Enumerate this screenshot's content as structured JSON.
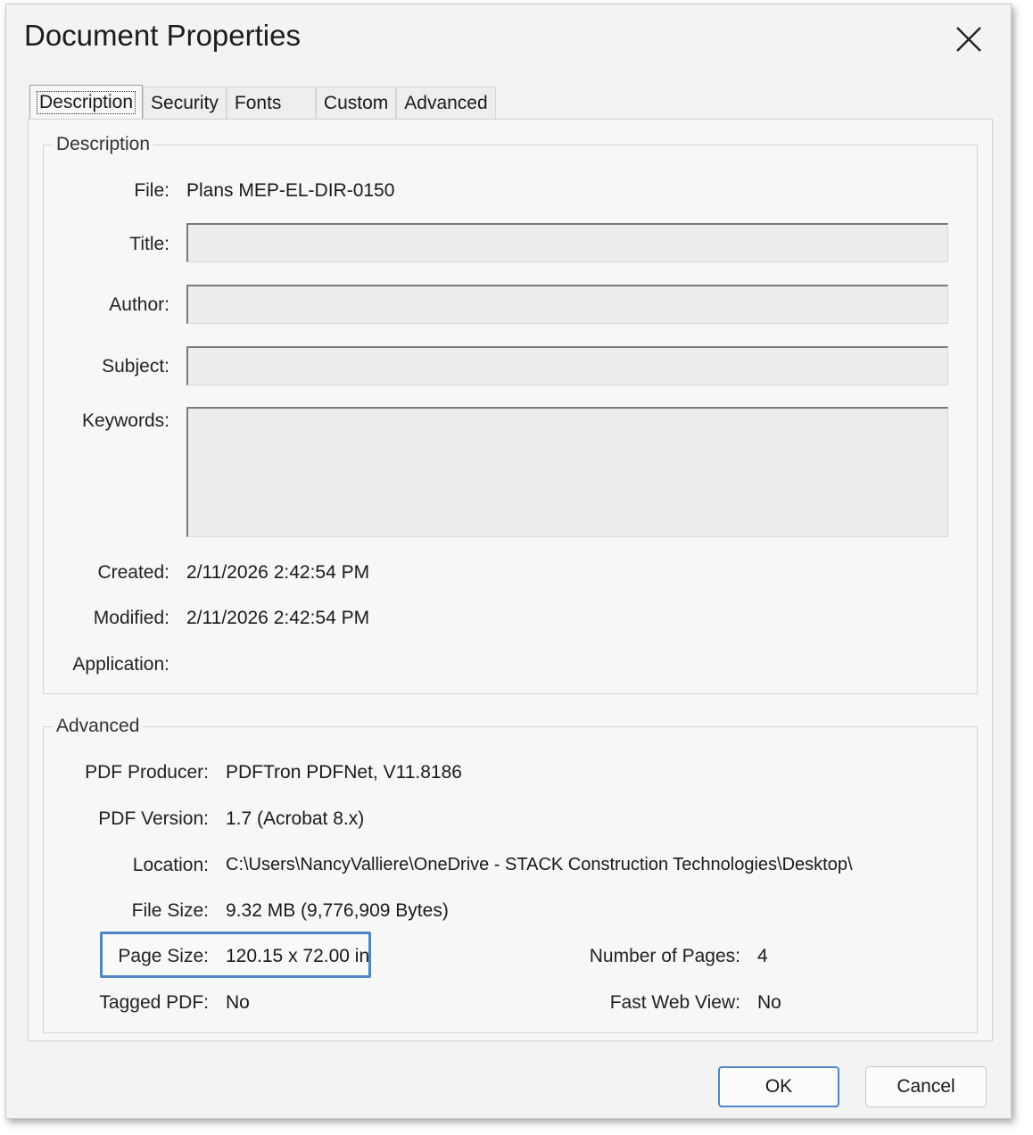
{
  "window": {
    "title": "Document Properties",
    "close_icon": "close-icon"
  },
  "tabs": [
    {
      "label": "Description",
      "active": true
    },
    {
      "label": "Security",
      "active": false
    },
    {
      "label": "Fonts",
      "active": false
    },
    {
      "label": "Custom",
      "active": false
    },
    {
      "label": "Advanced",
      "active": false
    }
  ],
  "description": {
    "legend": "Description",
    "file_label": "File:",
    "file_value": "Plans MEP-EL-DIR-0150",
    "title_label": "Title:",
    "title_value": "",
    "author_label": "Author:",
    "author_value": "",
    "subject_label": "Subject:",
    "subject_value": "",
    "keywords_label": "Keywords:",
    "keywords_value": "",
    "created_label": "Created:",
    "created_value": "2/11/2026 2:42:54 PM",
    "modified_label": "Modified:",
    "modified_value": "2/11/2026 2:42:54 PM",
    "application_label": "Application:",
    "application_value": ""
  },
  "advanced": {
    "legend": "Advanced",
    "producer_label": "PDF Producer:",
    "producer_value": "PDFTron PDFNet, V11.8186",
    "version_label": "PDF Version:",
    "version_value": "1.7 (Acrobat 8.x)",
    "location_label": "Location:",
    "location_value": "C:\\Users\\NancyValliere\\OneDrive - STACK Construction Technologies\\Desktop\\",
    "filesize_label": "File Size:",
    "filesize_value": "9.32 MB (9,776,909 Bytes)",
    "pagesize_label": "Page Size:",
    "pagesize_value": "120.15 x 72.00 in",
    "numpages_label": "Number of Pages:",
    "numpages_value": "4",
    "tagged_label": "Tagged PDF:",
    "tagged_value": "No",
    "fastweb_label": "Fast Web View:",
    "fastweb_value": "No"
  },
  "buttons": {
    "ok": "OK",
    "cancel": "Cancel"
  },
  "colors": {
    "highlight": "#4e86c4",
    "default_button_border": "#4f86c6"
  }
}
